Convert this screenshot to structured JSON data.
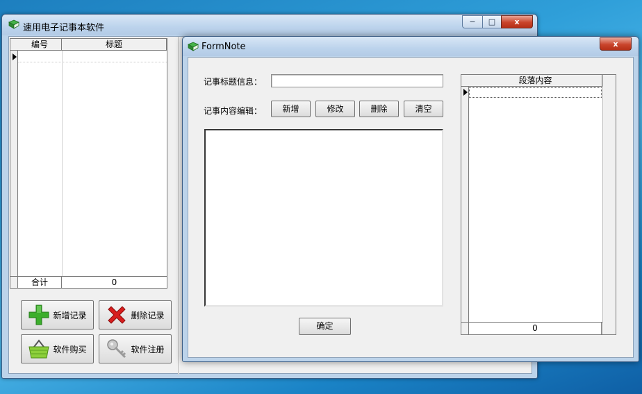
{
  "main_window": {
    "title": "速用电子记事本软件",
    "controls": {
      "minimize": "−",
      "maximize": "□",
      "close": "x"
    },
    "grid": {
      "columns": [
        "编号",
        "标题"
      ],
      "footer_label": "合计",
      "footer_value": "0"
    },
    "buttons": {
      "add": "新增记录",
      "delete": "删除记录",
      "buy": "软件购买",
      "register": "软件注册"
    }
  },
  "form_note": {
    "title": "FormNote",
    "close": "x",
    "title_label": "记事标题信息：",
    "title_value": "",
    "content_label": "记事内容编辑：",
    "buttons": {
      "add": "新增",
      "modify": "修改",
      "delete": "删除",
      "clear": "清空",
      "confirm": "确定"
    },
    "paragraph_grid": {
      "column": "段落内容",
      "footer_value": "0"
    }
  },
  "colors": {
    "accent_green": "#3cae2c",
    "delete_red": "#d81e1e",
    "close_red": "#c9442b"
  }
}
